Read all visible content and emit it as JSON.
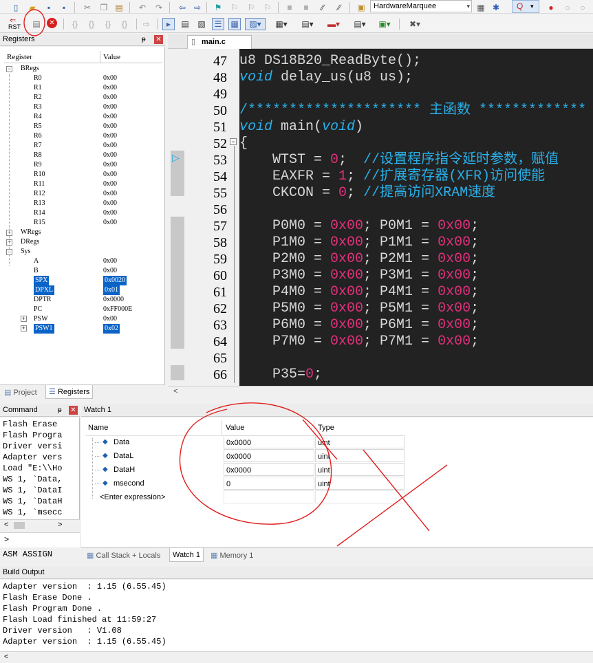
{
  "toolbar": {
    "target_select": "HardwareMarquee",
    "rst_label": "RST"
  },
  "registers_panel": {
    "title": "Registers",
    "col_register": "Register",
    "col_value": "Value",
    "groups": {
      "bregs": "BRegs",
      "wregs": "WRegs",
      "dregs": "DRegs",
      "sys": "Sys"
    },
    "bregs": [
      {
        "name": "R0",
        "value": "0x00"
      },
      {
        "name": "R1",
        "value": "0x00"
      },
      {
        "name": "R2",
        "value": "0x00"
      },
      {
        "name": "R3",
        "value": "0x00"
      },
      {
        "name": "R4",
        "value": "0x00"
      },
      {
        "name": "R5",
        "value": "0x00"
      },
      {
        "name": "R6",
        "value": "0x00"
      },
      {
        "name": "R7",
        "value": "0x00"
      },
      {
        "name": "R8",
        "value": "0x00"
      },
      {
        "name": "R9",
        "value": "0x00"
      },
      {
        "name": "R10",
        "value": "0x00"
      },
      {
        "name": "R11",
        "value": "0x00"
      },
      {
        "name": "R12",
        "value": "0x00"
      },
      {
        "name": "R13",
        "value": "0x00"
      },
      {
        "name": "R14",
        "value": "0x00"
      },
      {
        "name": "R15",
        "value": "0x00"
      }
    ],
    "sys": [
      {
        "name": "A",
        "value": "0x00"
      },
      {
        "name": "B",
        "value": "0x00"
      },
      {
        "name": "SPX",
        "value": "0x0020"
      },
      {
        "name": "DPXL",
        "value": "0x01"
      },
      {
        "name": "DPTR",
        "value": "0x0000"
      },
      {
        "name": "PC",
        "value": "0xFF000E"
      },
      {
        "name": "PSW",
        "value": "0x00"
      },
      {
        "name": "PSW1",
        "value": "0x02"
      }
    ],
    "tabs": {
      "project": "Project",
      "registers": "Registers"
    }
  },
  "editor": {
    "tab": "main.c",
    "lines": [
      {
        "n": "47",
        "code": "u8 DS18B20_ReadByte();"
      },
      {
        "n": "48",
        "code": "void delay_us(u8 us);"
      },
      {
        "n": "49",
        "code": ""
      },
      {
        "n": "50",
        "code": "/********************* 主函数 *************"
      },
      {
        "n": "51",
        "code": "void main(void)"
      },
      {
        "n": "52",
        "code": "{"
      },
      {
        "n": "53",
        "code": "    WTST = 0;  //设置程序指令延时参数，赋值"
      },
      {
        "n": "54",
        "code": "    EAXFR = 1; //扩展寄存器(XFR)访问使能"
      },
      {
        "n": "55",
        "code": "    CKCON = 0; //提高访问XRAM速度"
      },
      {
        "n": "56",
        "code": ""
      },
      {
        "n": "57",
        "code": "    P0M0 = 0x00; P0M1 = 0x00;"
      },
      {
        "n": "58",
        "code": "    P1M0 = 0x00; P1M1 = 0x00;"
      },
      {
        "n": "59",
        "code": "    P2M0 = 0x00; P2M1 = 0x00;"
      },
      {
        "n": "60",
        "code": "    P3M0 = 0x00; P3M1 = 0x00;"
      },
      {
        "n": "61",
        "code": "    P4M0 = 0x00; P4M1 = 0x00;"
      },
      {
        "n": "62",
        "code": "    P5M0 = 0x00; P5M1 = 0x00;"
      },
      {
        "n": "63",
        "code": "    P6M0 = 0x00; P6M1 = 0x00;"
      },
      {
        "n": "64",
        "code": "    P7M0 = 0x00; P7M1 = 0x00;"
      },
      {
        "n": "65",
        "code": ""
      },
      {
        "n": "66",
        "code": "    P35=0;"
      }
    ]
  },
  "command": {
    "title": "Command",
    "lines": [
      "Flash Erase",
      "Flash Progra",
      "Driver versi",
      "Adapter vers",
      "Load \"E:\\\\Ho",
      "WS 1, `Data,",
      "WS 1, `DataI",
      "WS 1, `DataH",
      "WS 1, `msecc"
    ],
    "prompt": ">",
    "assign": "ASM ASSIGN"
  },
  "watch": {
    "title": "Watch 1",
    "col_name": "Name",
    "col_value": "Value",
    "col_type": "Type",
    "rows": [
      {
        "name": "Data",
        "value": "0x0000",
        "type": "uint"
      },
      {
        "name": "DataL",
        "value": "0x0000",
        "type": "uint"
      },
      {
        "name": "DataH",
        "value": "0x0000",
        "type": "uint"
      },
      {
        "name": "msecond",
        "value": "0",
        "type": "uint"
      }
    ],
    "enter_expression": "<Enter expression>",
    "tabs": {
      "callstack": "Call Stack + Locals",
      "watch1": "Watch 1",
      "memory1": "Memory 1"
    }
  },
  "build": {
    "title": "Build Output",
    "lines": [
      "Adapter version  : 1.15 (6.55.45)",
      "Flash Erase Done .",
      "Flash Program Done .",
      "Flash Load finished at 11:59:27",
      "Driver version   : V1.08",
      "Adapter version  : 1.15 (6.55.45)"
    ]
  },
  "colors": {
    "editor_bg": "#222222",
    "selection": "#0a64c8",
    "annotation": "#e02020"
  }
}
